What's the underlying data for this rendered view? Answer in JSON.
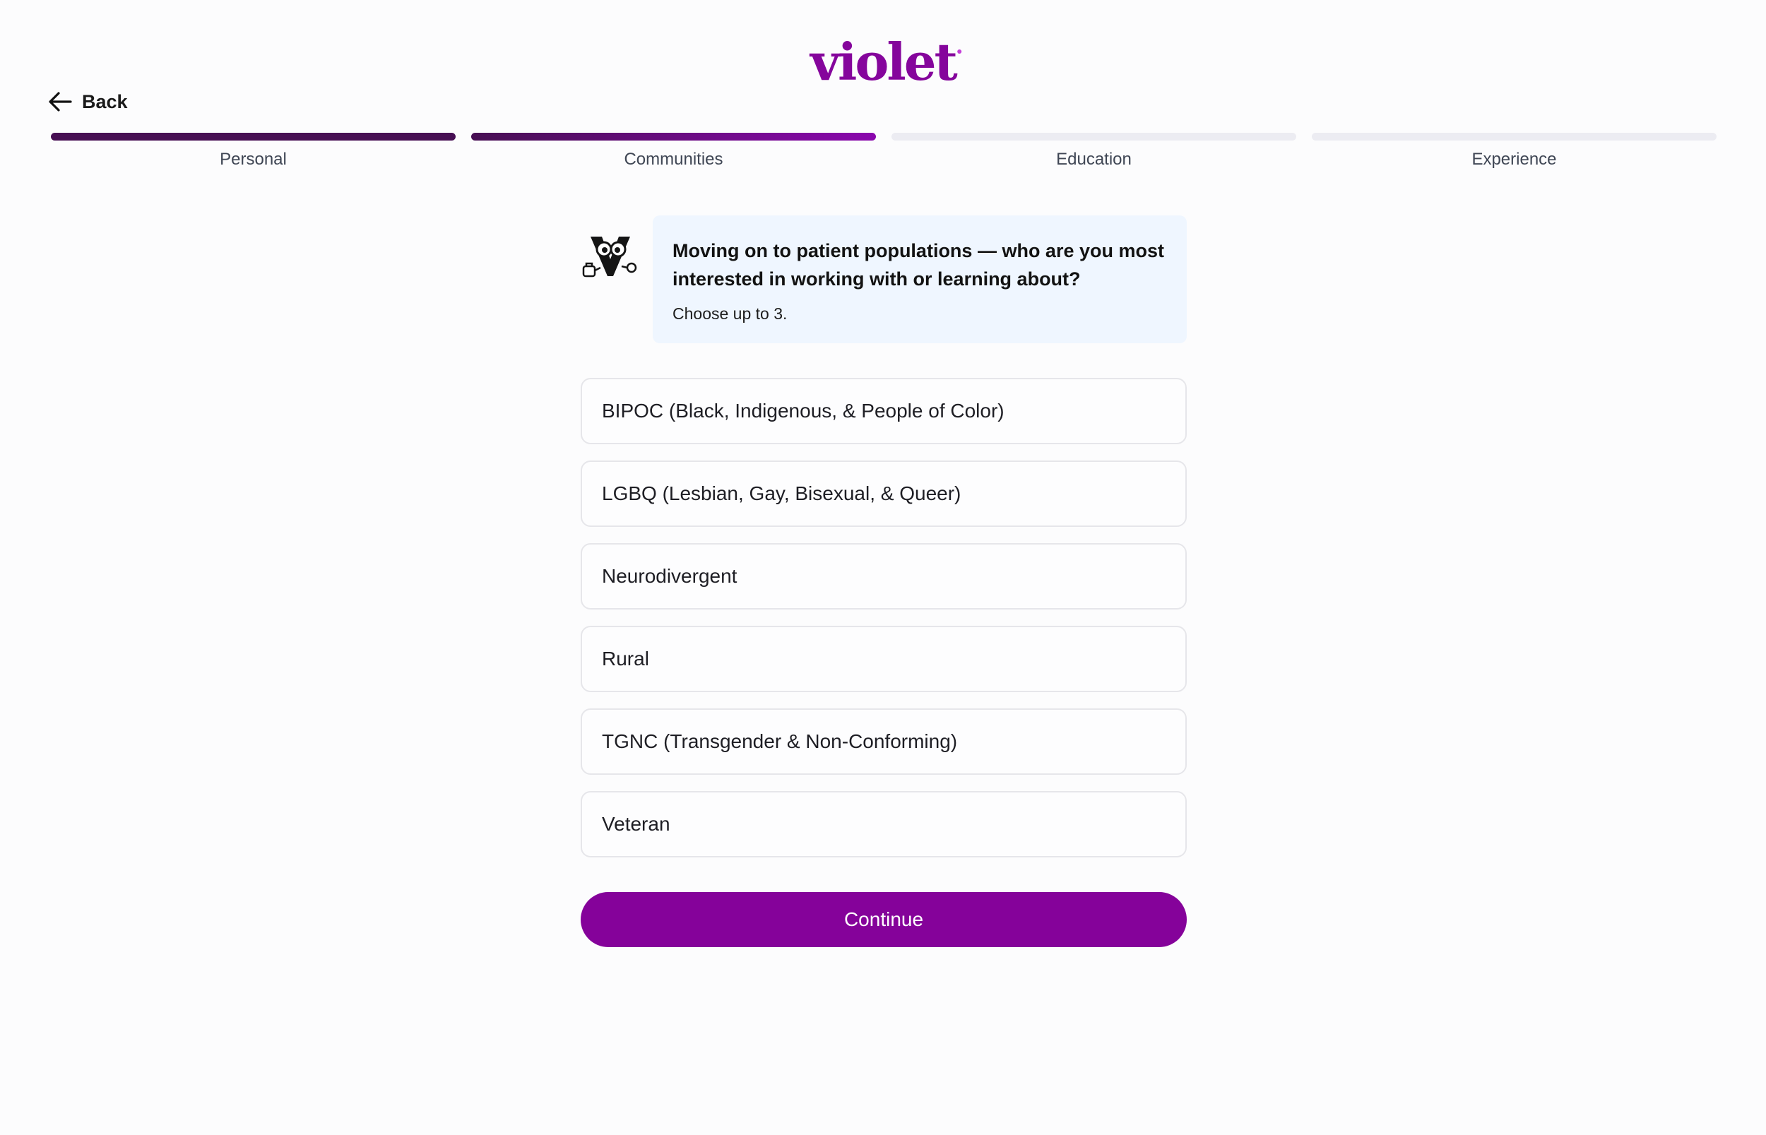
{
  "header": {
    "logo_text": "violet",
    "back_label": "Back",
    "back_icon": "arrow-left-icon"
  },
  "progress": {
    "steps": [
      {
        "label": "Personal",
        "state": "complete"
      },
      {
        "label": "Communities",
        "state": "current"
      },
      {
        "label": "Education",
        "state": "upcoming"
      },
      {
        "label": "Experience",
        "state": "upcoming"
      }
    ]
  },
  "question": {
    "mascot_icon": "violet-mascot-icon",
    "text": "Moving on to patient populations — who are you most interested in working with or learning about?",
    "subtext": "Choose up to 3."
  },
  "options": [
    {
      "label": "BIPOC (Black, Indigenous, & People of Color)"
    },
    {
      "label": "LGBQ (Lesbian, Gay, Bisexual, & Queer)"
    },
    {
      "label": "Neurodivergent"
    },
    {
      "label": "Rural"
    },
    {
      "label": "TGNC (Transgender & Non-Conforming)"
    },
    {
      "label": "Veteran"
    }
  ],
  "continue_label": "Continue",
  "colors": {
    "brand": "#85059c",
    "progress_done": "#470f53",
    "progress_empty": "#ececf2",
    "bubble_bg": "#eff6ff"
  }
}
